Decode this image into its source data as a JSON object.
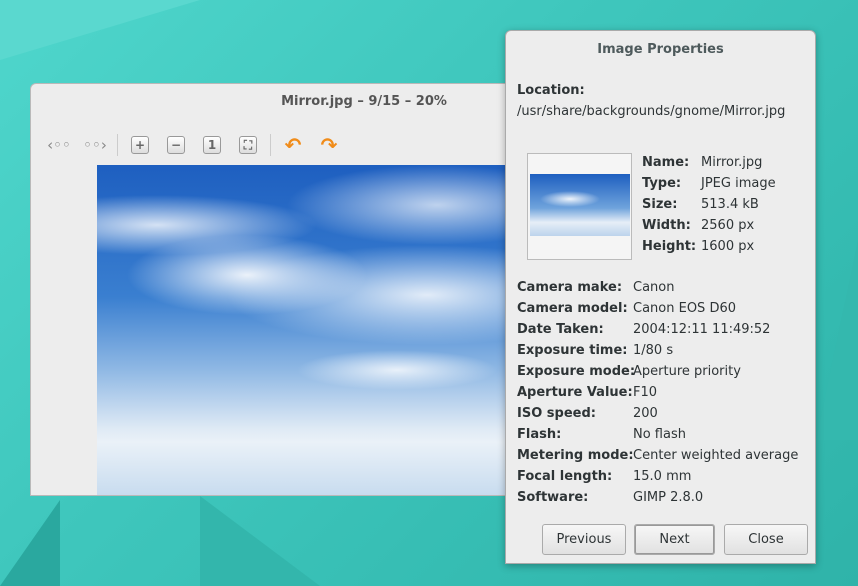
{
  "viewer": {
    "title": "Mirror.jpg – 9/15 – 20%",
    "toolbar": {
      "back": "‹◦◦",
      "forward": "◦◦›",
      "zoom_in": "+",
      "zoom_out": "−",
      "normal_size": "1",
      "fit": "⛶",
      "rotate_left": "↶",
      "rotate_right": "↷"
    }
  },
  "dialog": {
    "title": "Image Properties",
    "location_label": "Location:",
    "location": "/usr/share/backgrounds/gnome/Mirror.jpg",
    "general": [
      {
        "label": "Name:",
        "value": "Mirror.jpg"
      },
      {
        "label": "Type:",
        "value": "JPEG image"
      },
      {
        "label": "Size:",
        "value": "513.4 kB"
      },
      {
        "label": "Width:",
        "value": "2560 px"
      },
      {
        "label": "Height:",
        "value": "1600 px"
      }
    ],
    "exif": [
      {
        "label": "Camera make:",
        "value": "Canon"
      },
      {
        "label": "Camera model:",
        "value": "Canon EOS D60"
      },
      {
        "label": "Date Taken:",
        "value": "2004:12:11 11:49:52"
      },
      {
        "label": "Exposure time:",
        "value": "1/80 s"
      },
      {
        "label": "Exposure mode:",
        "value": "Aperture priority"
      },
      {
        "label": "Aperture Value:",
        "value": "F10"
      },
      {
        "label": "ISO speed:",
        "value": "200"
      },
      {
        "label": "Flash:",
        "value": "No flash"
      },
      {
        "label": "Metering mode:",
        "value": "Center weighted average"
      },
      {
        "label": "Focal length:",
        "value": "15.0 mm"
      },
      {
        "label": "Software:",
        "value": "GIMP 2.8.0"
      }
    ],
    "buttons": {
      "previous": "Previous",
      "next": "Next",
      "close": "Close"
    }
  }
}
